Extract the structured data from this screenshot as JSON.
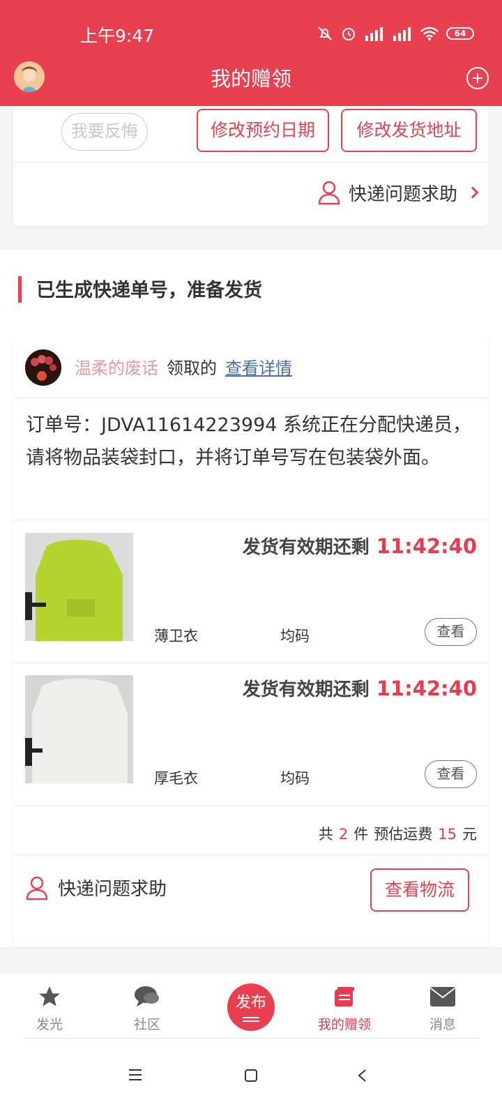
{
  "status_bar": {
    "time": "上午9:47",
    "battery": "64"
  },
  "header": {
    "title": "我的赠领"
  },
  "top_card": {
    "regret_label": "我要反悔",
    "change_date_label": "修改预约日期",
    "change_address_label": "修改发货地址",
    "help_label": "快递问题求助"
  },
  "section": {
    "title": "已生成快递单号，准备发货",
    "owner_name": "温柔的废话",
    "owner_action": "领取的",
    "details_link": "查看详情",
    "order_text": "订单号：JDVA11614223994 系统正在分配快递员，请将物品装袋封口，并将订单号写在包装袋外面。",
    "items": [
      {
        "deadline_label": "发货有效期还剩",
        "countdown": "11:42:40",
        "name": "薄卫衣",
        "size": "均码",
        "view_label": "查看"
      },
      {
        "deadline_label": "发货有效期还剩",
        "countdown": "11:42:40",
        "name": "厚毛衣",
        "size": "均码",
        "view_label": "查看"
      }
    ],
    "summary": {
      "prefix": "共",
      "count": "2",
      "unit": "件",
      "freight_label": "预估运费",
      "freight": "15",
      "currency": "元"
    },
    "help_label": "快递问题求助",
    "logistics_label": "查看物流"
  },
  "bottom_nav": [
    {
      "label": "发光",
      "icon": "star-icon"
    },
    {
      "label": "社区",
      "icon": "chat-icon"
    },
    {
      "label": "发布",
      "icon": "publish-icon"
    },
    {
      "label": "我的赠领",
      "icon": "gift-box-icon",
      "active": true
    },
    {
      "label": "消息",
      "icon": "mail-icon"
    }
  ],
  "colors": {
    "brand": "#e8404f",
    "countdown": "#e63c4e",
    "link": "#4a6fa5"
  }
}
